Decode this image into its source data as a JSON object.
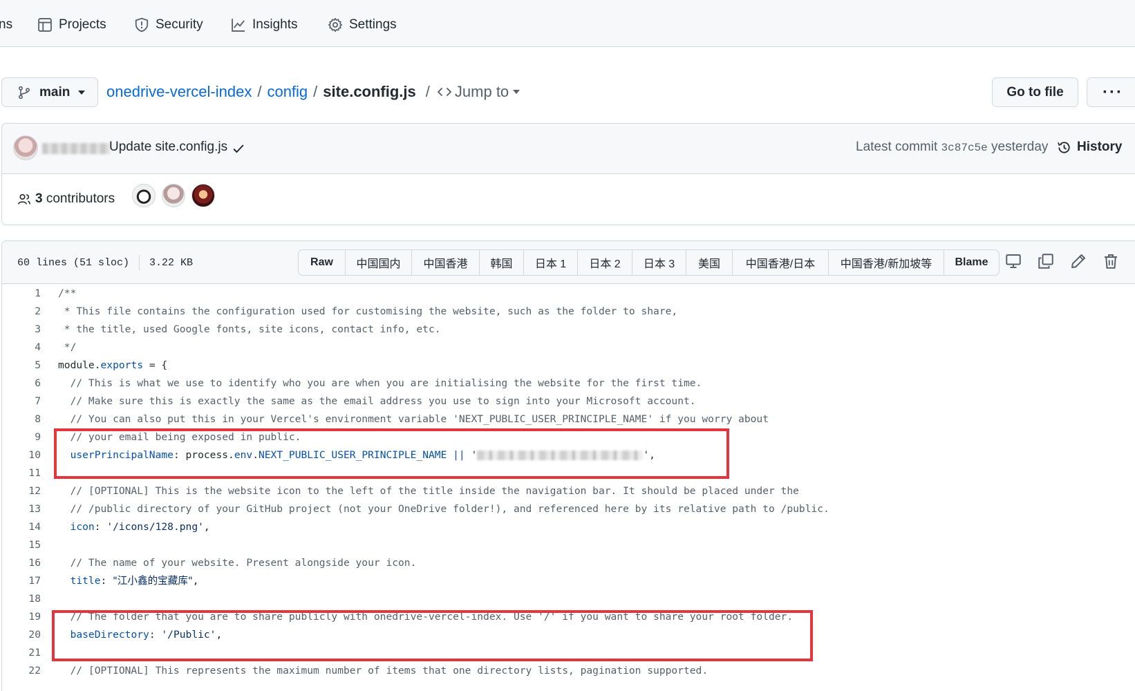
{
  "nav": {
    "cut_label": "ns",
    "projects": "Projects",
    "security": "Security",
    "insights": "Insights",
    "settings": "Settings"
  },
  "path": {
    "branch": "main",
    "repo": "onedrive-vercel-index",
    "sep": "/",
    "folder": "config",
    "file": "site.config.js",
    "jump": "Jump to",
    "goto_file": "Go to file",
    "more": "···"
  },
  "commit": {
    "message": "Update site.config.js",
    "latest_label": "Latest commit",
    "sha": "3c87c5e",
    "when": "yesterday",
    "history": "History",
    "contributors_count": "3",
    "contributors_label": "contributors"
  },
  "file": {
    "lines": "60 lines (51 sloc)",
    "size": "3.22 KB",
    "buttons": [
      "Raw",
      "中国国内",
      "中国香港",
      "韩国",
      "日本 1",
      "日本 2",
      "日本 3",
      "美国",
      "中国香港/日本",
      "中国香港/新加坡等",
      "Blame"
    ]
  },
  "code": {
    "numbers": [
      "1",
      "2",
      "3",
      "4",
      "5",
      "6",
      "7",
      "8",
      "9",
      "10",
      "11",
      "12",
      "13",
      "14",
      "15",
      "16",
      "17",
      "18",
      "19",
      "20",
      "21",
      "22"
    ],
    "l1": "/**",
    "l2": " * This file contains the configuration used for customising the website, such as the folder to share,",
    "l3": " * the title, used Google fonts, site icons, contact info, etc.",
    "l4": " */",
    "l5_a": "module.",
    "l5_b": "exports",
    "l5_c": " = {",
    "l6": "  // This is what we use to identify who you are when you are initialising the website for the first time.",
    "l7": "  // Make sure this is exactly the same as the email address you use to sign into your Microsoft account.",
    "l8": "  // You can also put this in your Vercel's environment variable 'NEXT_PUBLIC_USER_PRINCIPLE_NAME' if you worry about",
    "l9": "  // your email being exposed in public.",
    "l10_key": "userPrincipalName",
    "l10_a": ": process.",
    "l10_env": "env",
    "l10_dot": ".",
    "l10_var": "NEXT_PUBLIC_USER_PRINCIPLE_NAME",
    "l10_or": " || ",
    "l10_q1": "'",
    "l10_q2": "'",
    "l10_end": ",",
    "l12": "  // [OPTIONAL] This is the website icon to the left of the title inside the navigation bar. It should be placed under the",
    "l13": "  // /public directory of your GitHub project (not your OneDrive folder!), and referenced here by its relative path to /public.",
    "l14_key": "icon",
    "l14_val": "'/icons/128.png'",
    "l16": "  // The name of your website. Present alongside your icon.",
    "l17_key": "title",
    "l17_val": "\"江小鑫的宝藏库\"",
    "l19": "  // The folder that you are to share publicly with onedrive-vercel-index. Use '/' if you want to share your root folder.",
    "l20_key": "baseDirectory",
    "l20_val": "'/Public'",
    "l22": "  // [OPTIONAL] This represents the maximum number of items that one directory lists, pagination supported."
  }
}
